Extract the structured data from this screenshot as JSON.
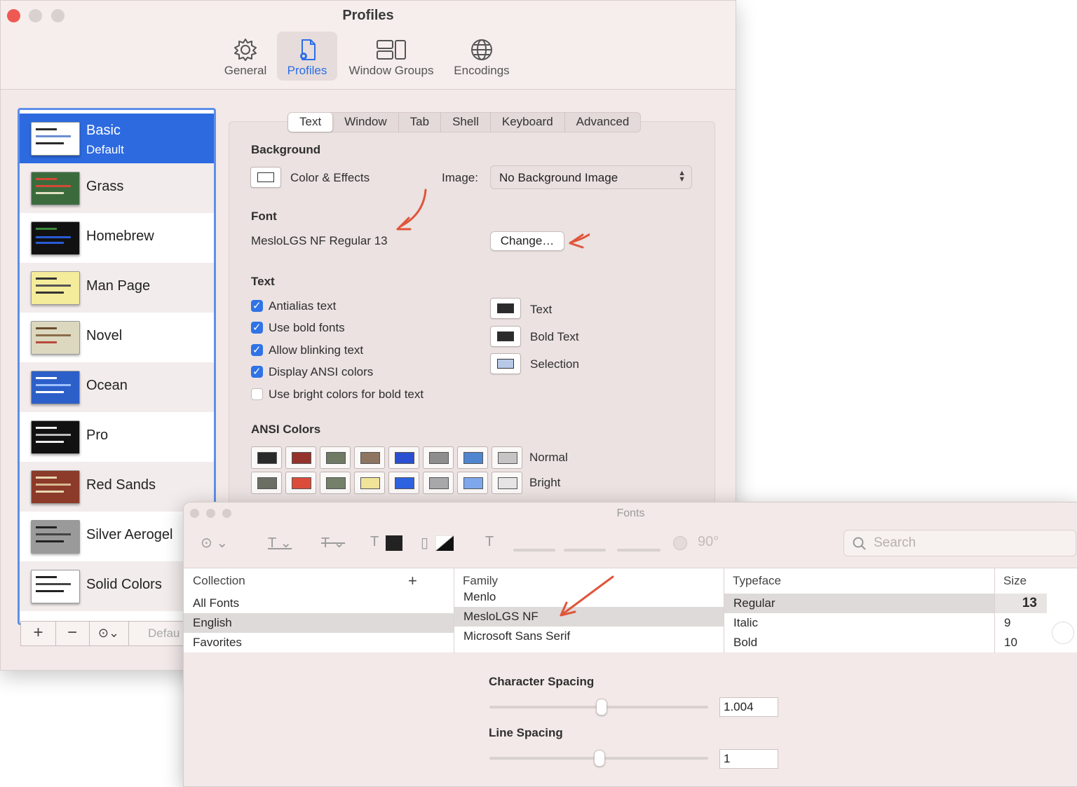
{
  "prefs": {
    "title": "Profiles",
    "toolbar": [
      {
        "label": "General",
        "icon": "gear-icon"
      },
      {
        "label": "Profiles",
        "icon": "profiles-doc-icon",
        "selected": true
      },
      {
        "label": "Window Groups",
        "icon": "window-groups-icon"
      },
      {
        "label": "Encodings",
        "icon": "globe-icon"
      }
    ],
    "profiles": [
      {
        "name": "Basic",
        "subtitle": "Default",
        "selected": true,
        "thumb_bg": "#ffffff",
        "thumb_fg": "#2a2a2a"
      },
      {
        "name": "Grass",
        "thumb_bg": "#3b6b3d",
        "thumb_fg": "#d44a36"
      },
      {
        "name": "Homebrew",
        "thumb_bg": "#111111",
        "thumb_fg": "#2a5bd6"
      },
      {
        "name": "Man Page",
        "thumb_bg": "#f4ec9a",
        "thumb_fg": "#333333"
      },
      {
        "name": "Novel",
        "thumb_bg": "#dcd8c0",
        "thumb_fg": "#6a4c2c"
      },
      {
        "name": "Ocean",
        "thumb_bg": "#2d5fc9",
        "thumb_fg": "#ffffff"
      },
      {
        "name": "Pro",
        "thumb_bg": "#111111",
        "thumb_fg": "#eeeeee"
      },
      {
        "name": "Red Sands",
        "thumb_bg": "#8c3a2a",
        "thumb_fg": "#e8d8b0"
      },
      {
        "name": "Silver Aerogel",
        "thumb_bg": "#9a9a9a",
        "thumb_fg": "#222222"
      },
      {
        "name": "Solid Colors",
        "thumb_bg": "#ffffff",
        "thumb_fg": "#222222"
      }
    ],
    "list_buttons": {
      "add": "+",
      "remove": "−",
      "more": "⊙⌄",
      "default": "Defau"
    },
    "tabs": [
      "Text",
      "Window",
      "Tab",
      "Shell",
      "Keyboard",
      "Advanced"
    ],
    "background": {
      "heading": "Background",
      "color_effects": "Color & Effects",
      "image_label": "Image:",
      "image_value": "No Background Image"
    },
    "font": {
      "heading": "Font",
      "value": "MesloLGS NF Regular 13",
      "change_button": "Change…"
    },
    "text": {
      "heading": "Text",
      "checkboxes": [
        {
          "label": "Antialias text",
          "checked": true
        },
        {
          "label": "Use bold fonts",
          "checked": true
        },
        {
          "label": "Allow blinking text",
          "checked": true
        },
        {
          "label": "Display ANSI colors",
          "checked": true
        },
        {
          "label": "Use bright colors for bold text",
          "checked": false
        }
      ],
      "colors": [
        {
          "label": "Text",
          "color": "#2b2b2b"
        },
        {
          "label": "Bold Text",
          "color": "#2b2b2b"
        },
        {
          "label": "Selection",
          "color": "#b7c9e6"
        }
      ]
    },
    "ansi": {
      "heading": "ANSI Colors",
      "normal_label": "Normal",
      "bright_label": "Bright",
      "normal": [
        "#2a2a2a",
        "#96322c",
        "#6e7a63",
        "#8e7561",
        "#2a4fd0",
        "#8e8e8e",
        "#4f86cf",
        "#c6c4c4"
      ],
      "bright": [
        "#6a6e63",
        "#db4d3a",
        "#748069",
        "#f1e49a",
        "#2d63e0",
        "#a8a8aa",
        "#7fa8ec",
        "#e6e4e4"
      ]
    }
  },
  "fonts_panel": {
    "title": "Fonts",
    "rotation": "90°",
    "search_placeholder": "Search",
    "headers": {
      "collection": "Collection",
      "family": "Family",
      "typeface": "Typeface",
      "size": "Size"
    },
    "add_collection": "+",
    "collections": [
      {
        "name": "All Fonts"
      },
      {
        "name": "English",
        "selected": true
      },
      {
        "name": "Favorites"
      }
    ],
    "families": [
      {
        "name": "Menlo"
      },
      {
        "name": "MesloLGS NF",
        "selected": true
      },
      {
        "name": "Microsoft Sans Serif"
      }
    ],
    "typefaces": [
      {
        "name": "Regular",
        "selected": true
      },
      {
        "name": "Italic"
      },
      {
        "name": "Bold"
      }
    ],
    "sizes": [
      "13",
      "9",
      "10"
    ],
    "character_spacing": {
      "label": "Character Spacing",
      "value": "1.004",
      "level": 0.51
    },
    "line_spacing": {
      "label": "Line Spacing",
      "value": "1",
      "level": 0.5
    }
  },
  "annotation_color": "#e0553a"
}
